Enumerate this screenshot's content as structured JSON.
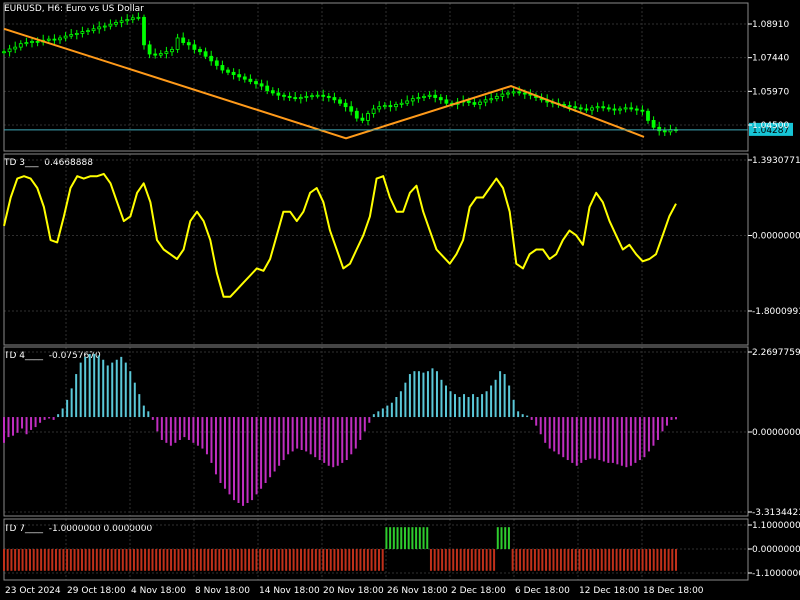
{
  "chart_data": [
    {
      "type": "candlestick",
      "title": "EURUSD, H6:  Euro vs US Dollar",
      "y_ticks": [
        "1.08910",
        "1.07440",
        "1.05970",
        "1.04500"
      ],
      "ylim": [
        1.036,
        1.0955
      ],
      "current_price": "1.04287",
      "close_series": [
        1.077,
        1.0782,
        1.079,
        1.0805,
        1.081,
        1.0815,
        1.0812,
        1.082,
        1.0825,
        1.0822,
        1.083,
        1.0838,
        1.0845,
        1.085,
        1.0858,
        1.0862,
        1.087,
        1.0878,
        1.0882,
        1.089,
        1.0898,
        1.0905,
        1.091,
        1.0918,
        1.092,
        1.08,
        1.076,
        1.0755,
        1.0762,
        1.077,
        1.078,
        1.083,
        1.081,
        1.08,
        1.078,
        1.077,
        1.075,
        1.073,
        1.071,
        1.069,
        1.068,
        1.067,
        1.066,
        1.065,
        1.064,
        1.063,
        1.062,
        1.06,
        1.059,
        1.058,
        1.0575,
        1.057,
        1.0565,
        1.057,
        1.0575,
        1.0578,
        1.058,
        1.0575,
        1.057,
        1.056,
        1.0545,
        1.053,
        1.051,
        1.048,
        1.047,
        1.05,
        1.052,
        1.053,
        1.0535,
        1.053,
        1.054,
        1.0545,
        1.0555,
        1.0565,
        1.057,
        1.0575,
        1.058,
        1.057,
        1.056,
        1.0545,
        1.054,
        1.055,
        1.0555,
        1.0548,
        1.054,
        1.055,
        1.056,
        1.0565,
        1.0575,
        1.0585,
        1.059,
        1.0595,
        1.059,
        1.0585,
        1.058,
        1.057,
        1.056,
        1.055,
        1.0545,
        1.054,
        1.0535,
        1.053,
        1.0525,
        1.052,
        1.0515,
        1.0525,
        1.053,
        1.0525,
        1.052,
        1.0515,
        1.052,
        1.0525,
        1.052,
        1.0515,
        1.051,
        1.047,
        1.044,
        1.0425,
        1.042,
        1.043,
        1.0428
      ],
      "trend_line": [
        {
          "x": "23 Oct 2024",
          "y": 1.087
        },
        {
          "x": "21 Nov 06:00",
          "y": 1.0392
        },
        {
          "x": "5 Dec 18:00",
          "y": 1.062
        },
        {
          "x": "18 Dec 06:00",
          "y": 1.0398
        }
      ]
    },
    {
      "type": "line",
      "title": "TD 3___",
      "value": "0.4668888",
      "y_ticks": [
        "1.3930771",
        "0.0000000",
        "-1.8000993"
      ],
      "ylim": [
        -1.8000993,
        1.3930771
      ],
      "color": "#ffff00",
      "series": [
        {
          "values": [
            0.0,
            0.6,
            1.0,
            1.05,
            1.0,
            0.8,
            0.4,
            -0.3,
            -0.35,
            0.2,
            0.8,
            1.05,
            1.0,
            1.05,
            1.05,
            1.1,
            0.9,
            0.5,
            0.1,
            0.2,
            0.7,
            0.9,
            0.5,
            -0.3,
            -0.5,
            -0.6,
            -0.7,
            -0.5,
            0.1,
            0.3,
            0.1,
            -0.3,
            -1.0,
            -1.5,
            -1.5,
            -1.35,
            -1.2,
            -1.05,
            -0.9,
            -0.95,
            -0.7,
            -0.2,
            0.3,
            0.3,
            0.1,
            0.3,
            0.7,
            0.8,
            0.5,
            -0.1,
            -0.5,
            -0.9,
            -0.8,
            -0.5,
            -0.2,
            0.2,
            1.0,
            1.05,
            0.6,
            0.3,
            0.3,
            0.7,
            0.85,
            0.3,
            -0.1,
            -0.5,
            -0.65,
            -0.8,
            -0.6,
            -0.3,
            0.4,
            0.6,
            0.6,
            0.8,
            1.0,
            0.8,
            0.3,
            -0.8,
            -0.9,
            -0.6,
            -0.5,
            -0.5,
            -0.7,
            -0.6,
            -0.3,
            -0.1,
            -0.2,
            -0.4,
            0.4,
            0.7,
            0.5,
            0.1,
            -0.2,
            -0.5,
            -0.4,
            -0.6,
            -0.75,
            -0.7,
            -0.6,
            -0.2,
            0.2,
            0.47
          ]
        }
      ]
    },
    {
      "type": "bar",
      "title": "TD 4____",
      "value": "-0.0757670",
      "y_ticks": [
        "2.2697759",
        "0.0000000",
        "-3.3134423"
      ],
      "ylim": [
        -3.3134423,
        2.2697759
      ],
      "positive_color": "#5bc8d8",
      "negative_color": "#c02ec0",
      "values": [
        -0.9,
        -0.7,
        -0.65,
        -0.55,
        -0.4,
        -0.6,
        -0.45,
        -0.35,
        -0.2,
        -0.1,
        -0.05,
        -0.1,
        0.1,
        0.3,
        0.6,
        1.0,
        1.5,
        1.9,
        2.1,
        2.2,
        2.2,
        2.15,
        2.0,
        1.8,
        1.9,
        2.0,
        2.1,
        1.9,
        1.6,
        1.2,
        0.8,
        0.4,
        0.2,
        -0.1,
        -0.5,
        -0.8,
        -0.9,
        -1.0,
        -0.9,
        -0.8,
        -0.7,
        -0.8,
        -0.9,
        -1.0,
        -1.1,
        -1.3,
        -1.6,
        -2.0,
        -2.3,
        -2.5,
        -2.7,
        -2.9,
        -3.0,
        -3.1,
        -3.0,
        -2.9,
        -2.7,
        -2.5,
        -2.3,
        -2.1,
        -1.9,
        -1.7,
        -1.5,
        -1.3,
        -1.2,
        -1.1,
        -1.15,
        -1.2,
        -1.3,
        -1.4,
        -1.5,
        -1.6,
        -1.7,
        -1.75,
        -1.7,
        -1.6,
        -1.5,
        -1.3,
        -1.1,
        -0.8,
        -0.5,
        -0.2,
        0.1,
        0.2,
        0.3,
        0.4,
        0.5,
        0.7,
        0.9,
        1.2,
        1.5,
        1.6,
        1.6,
        1.55,
        1.6,
        1.7,
        1.6,
        1.3,
        1.1,
        0.9,
        0.8,
        0.7,
        0.8,
        0.7,
        0.8,
        0.7,
        0.8,
        0.9,
        1.1,
        1.3,
        1.6,
        1.5,
        1.1,
        0.6,
        0.2,
        0.1,
        0.05,
        -0.1,
        -0.3,
        -0.6,
        -0.9,
        -1.1,
        -1.2,
        -1.3,
        -1.4,
        -1.5,
        -1.6,
        -1.7,
        -1.6,
        -1.5,
        -1.45,
        -1.45,
        -1.5,
        -1.55,
        -1.6,
        -1.6,
        -1.65,
        -1.7,
        -1.75,
        -1.7,
        -1.6,
        -1.5,
        -1.4,
        -1.2,
        -1.0,
        -0.8,
        -0.5,
        -0.3,
        -0.1,
        -0.08
      ]
    },
    {
      "type": "bar",
      "title": "TD 7____",
      "value": "-1.0000000 0.0000000",
      "y_ticks": [
        "1.1000000",
        "0.0000000",
        "-1.1000000"
      ],
      "ylim": [
        -1.1,
        1.1
      ],
      "positive_color": "#2ecc2e",
      "negative_color": "#c0301a",
      "segments": [
        {
          "value": -1,
          "bars": 103
        },
        {
          "value": 1,
          "bars": 12
        },
        {
          "value": -1,
          "bars": 18
        },
        {
          "value": 1,
          "bars": 4
        },
        {
          "value": -1,
          "bars": 45
        }
      ]
    }
  ],
  "x_ticks": [
    "23 Oct 2024",
    "29 Oct 18:00",
    "4 Nov 18:00",
    "8 Nov 18:00",
    "14 Nov 18:00",
    "20 Nov 18:00",
    "26 Nov 18:00",
    "2 Dec 18:00",
    "6 Dec 18:00",
    "12 Dec 18:00",
    "18 Dec 18:00"
  ],
  "colors": {
    "bg": "#000000",
    "grid": "#2f2f2f",
    "axis": "#ffffff",
    "candle": "#00ff00",
    "trend": "#ff9a1a",
    "current_line": "#3fa9b8",
    "current_badge": "#17c5d6"
  }
}
